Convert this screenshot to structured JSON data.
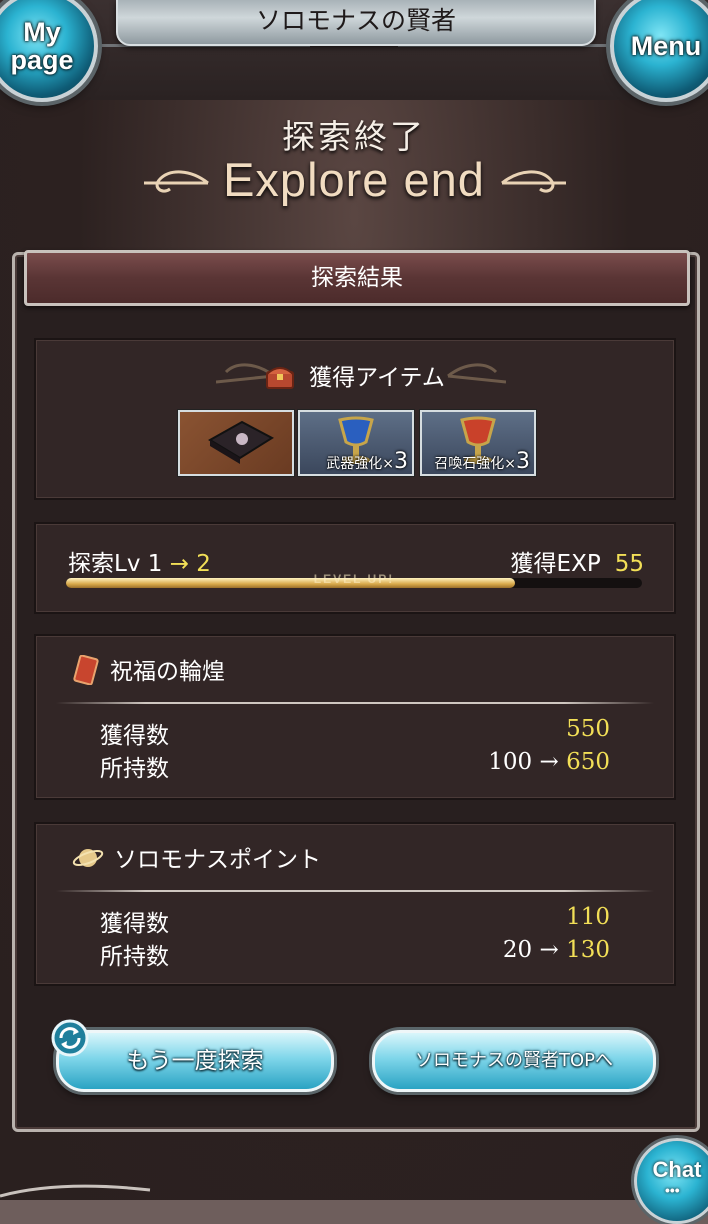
{
  "header": {
    "title": "ソロモナスの賢者",
    "mypage_label_line1": "My",
    "mypage_label_line2": "page",
    "menu_label": "Menu"
  },
  "hero": {
    "title_jp": "探索終了",
    "title_en": "Explore end"
  },
  "panel": {
    "title": "探索結果"
  },
  "items": {
    "heading": "獲得アイテム",
    "list": [
      {
        "name": "book",
        "caption": "",
        "qty": ""
      },
      {
        "name": "blue-chalice",
        "caption": "武器強化",
        "qty": "3"
      },
      {
        "name": "red-chalice",
        "caption": "召喚石強化",
        "qty": "3"
      }
    ],
    "qty_prefix": "×"
  },
  "level": {
    "label": "探索Lv 1",
    "arrow": "→",
    "new_level": "2",
    "exp_label": "獲得EXP",
    "exp_value": "55",
    "bar_text": "LEVEL UP!",
    "progress": 0.78
  },
  "currency": {
    "name": "祝福の輪煌",
    "gained_label": "獲得数",
    "gained_value": "550",
    "owned_label": "所持数",
    "owned_before": "100",
    "owned_arrow": "→",
    "owned_after": "650"
  },
  "points": {
    "name": "ソロモナスポイント",
    "gained_label": "獲得数",
    "gained_value": "110",
    "owned_label": "所持数",
    "owned_before": "20",
    "owned_arrow": "→",
    "owned_after": "130"
  },
  "buttons": {
    "again": "もう一度探索",
    "top": "ソロモナスの賢者TOPへ"
  },
  "chat": {
    "label": "Chat",
    "dots": "•••"
  },
  "colors": {
    "highlight": "#f2df57",
    "panel_bg": "#281f1f",
    "button_cyan": "#7fd6ea"
  }
}
